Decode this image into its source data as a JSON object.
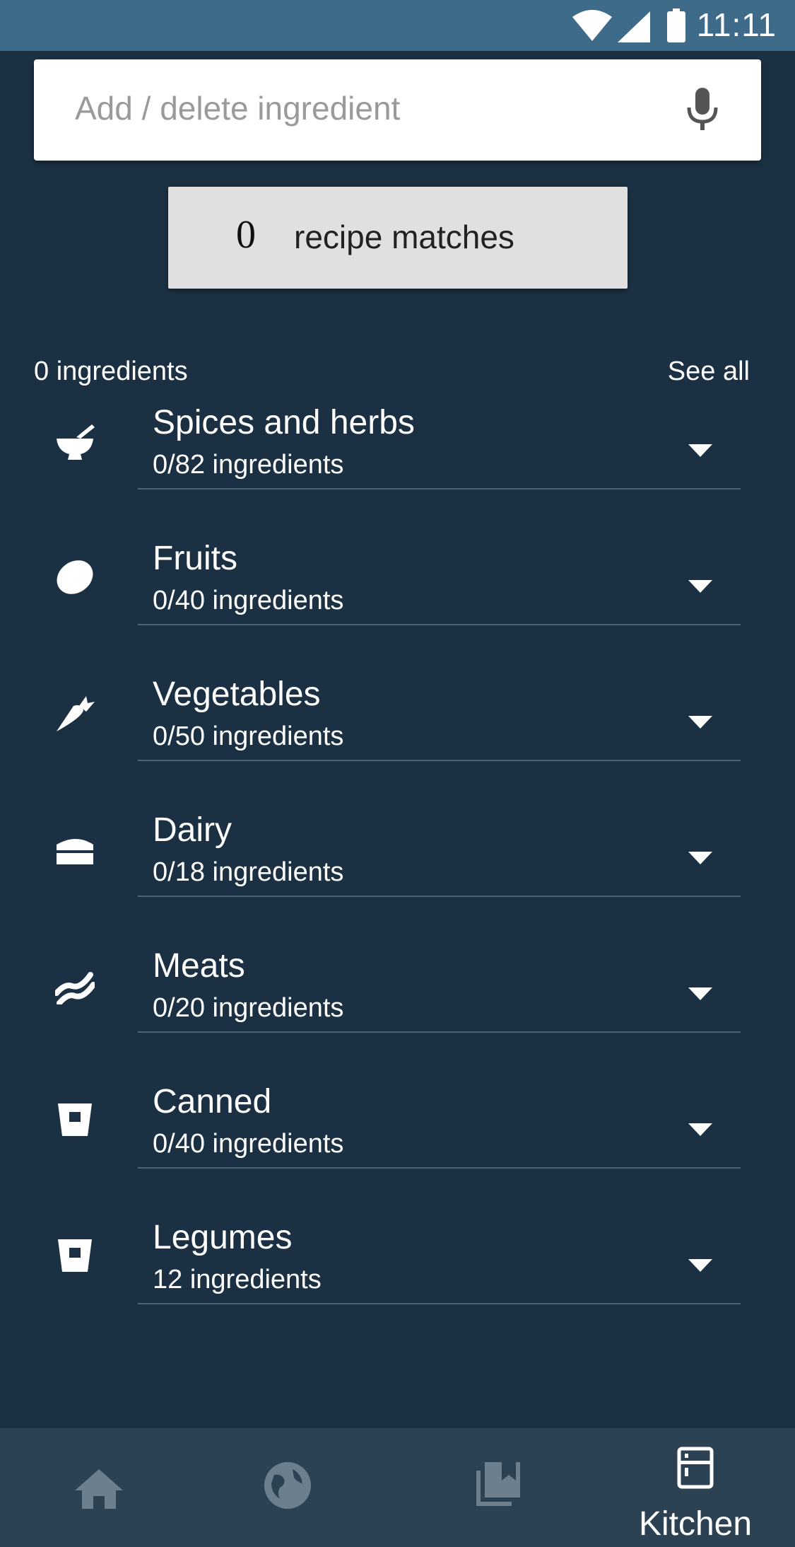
{
  "status_bar": {
    "time": "11:11",
    "icons": [
      "wifi-icon",
      "signal-icon",
      "battery-icon"
    ]
  },
  "search": {
    "placeholder": "Add / delete ingredient",
    "value": "",
    "icon": "mic-icon"
  },
  "matches": {
    "count": "0",
    "label": "recipe matches"
  },
  "ingredients_header": {
    "total": "0 ingredients",
    "see_all": "See all"
  },
  "categories": [
    {
      "name": "Spices and herbs",
      "count": "0/82 ingredients",
      "icon": "mortar-pestle-icon"
    },
    {
      "name": "Fruits",
      "count": "0/40 ingredients",
      "icon": "lemon-icon"
    },
    {
      "name": "Vegetables",
      "count": "0/50 ingredients",
      "icon": "carrot-icon"
    },
    {
      "name": "Dairy",
      "count": "0/18 ingredients",
      "icon": "cheese-icon"
    },
    {
      "name": "Meats",
      "count": "0/20 ingredients",
      "icon": "bacon-icon"
    },
    {
      "name": "Canned",
      "count": "0/40 ingredients",
      "icon": "can-icon"
    },
    {
      "name": "Legumes",
      "count": "12 ingredients",
      "icon": "can-icon"
    }
  ],
  "bottom_nav": {
    "items": [
      {
        "icon": "home-icon",
        "label": ""
      },
      {
        "icon": "globe-icon",
        "label": ""
      },
      {
        "icon": "cookbook-icon",
        "label": ""
      },
      {
        "icon": "fridge-icon",
        "label": "Kitchen"
      }
    ],
    "active_index": 3
  },
  "colors": {
    "background": "#1b3042",
    "status_bar": "#3e6b8a",
    "bottom_nav": "#2c4253",
    "inactive_icon": "#6d7f8c"
  }
}
